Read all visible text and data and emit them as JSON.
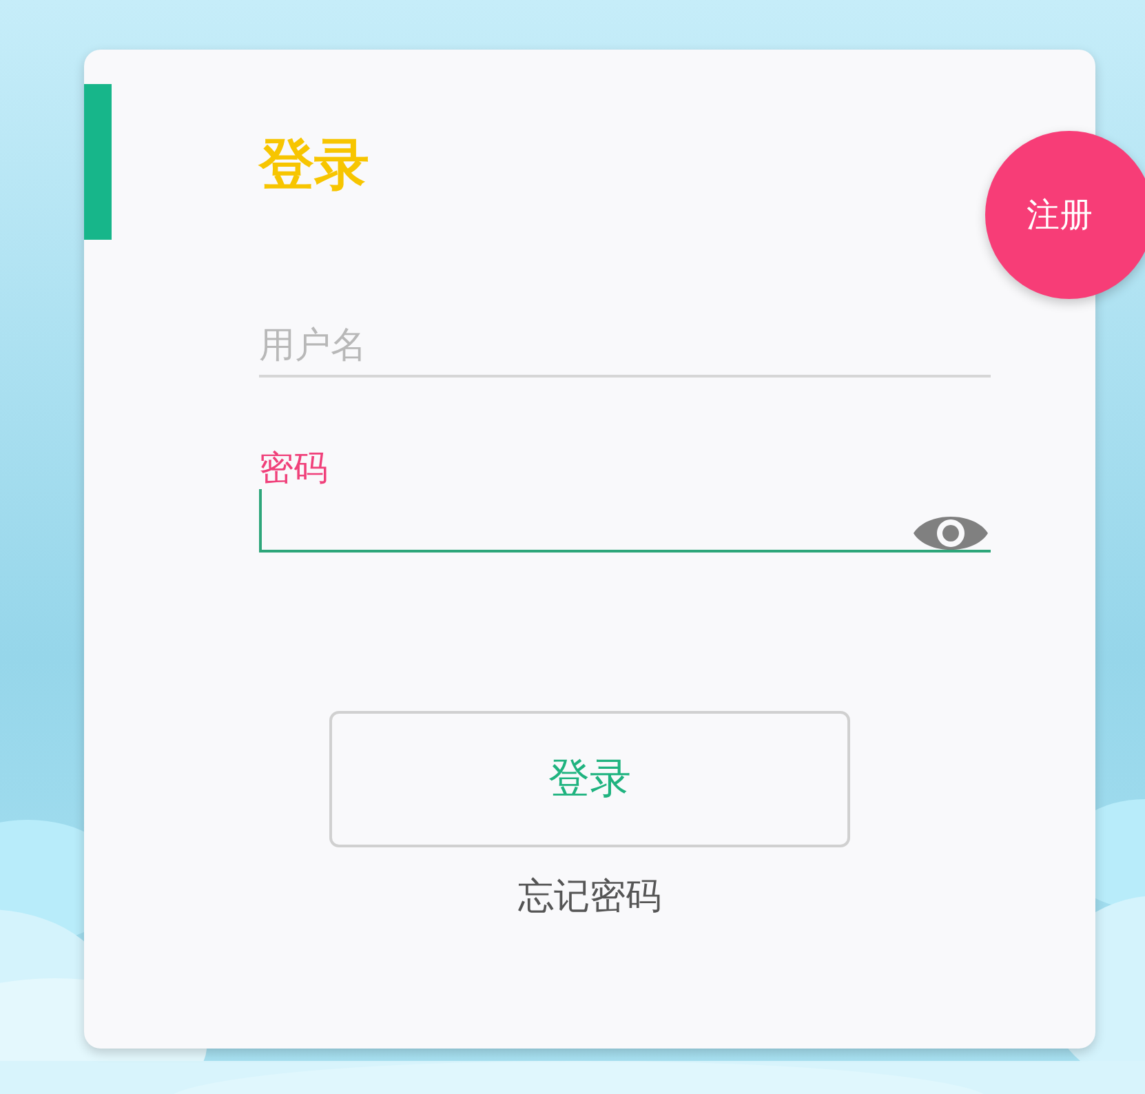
{
  "title": "登录",
  "register_button": "注册",
  "fields": [
    {
      "kind": "text",
      "label": "用户名",
      "focused": false
    },
    {
      "kind": "password",
      "label": "密码",
      "focused": true
    }
  ],
  "login_button": "登录",
  "forgot_link": "忘记密码"
}
